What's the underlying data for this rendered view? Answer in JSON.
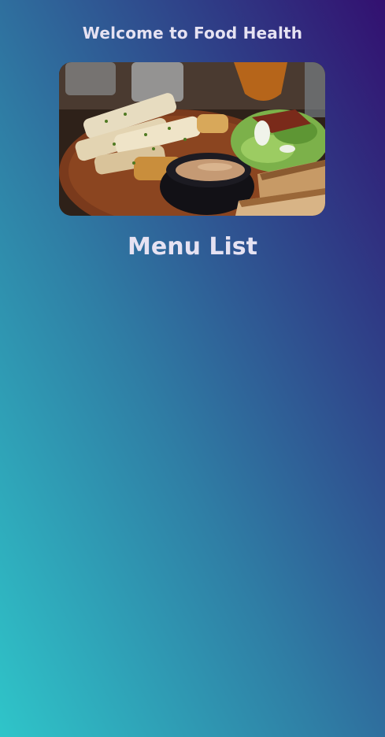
{
  "header": {
    "title": "Welcome to Food Health"
  },
  "hero": {
    "subject": "plate of grilled halloumi with dipping sauce, salad and bread"
  },
  "menu": {
    "title": "Menu List",
    "items": []
  },
  "colors": {
    "gradient_top_right": "#331070",
    "gradient_bottom_left": "#2fc5c9",
    "title_text": "#e6e2f2"
  }
}
